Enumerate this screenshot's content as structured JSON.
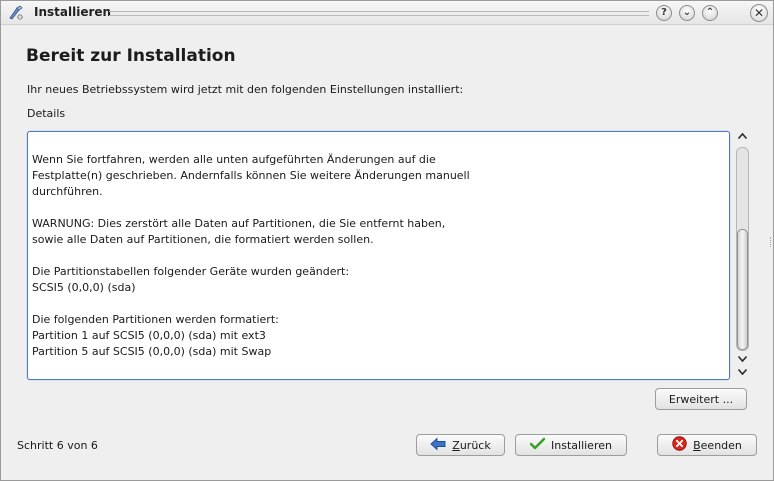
{
  "window": {
    "title": "Installieren",
    "help_glyph": "?",
    "min_glyph": "⌄",
    "max_glyph": "⌃",
    "close_glyph": "✕"
  },
  "page": {
    "title": "Bereit zur Installation",
    "intro": "Ihr neues Betriebssystem wird jetzt mit den folgenden Einstellungen installiert:",
    "details_label": "Details"
  },
  "details": {
    "text": "Wenn Sie fortfahren, werden alle unten aufgeführten Änderungen auf die\nFestplatte(n) geschrieben. Andernfalls können Sie weitere Änderungen manuell\ndurchführen.\n\nWARNUNG: Dies zerstört alle Daten auf Partitionen, die Sie entfernt haben,\nsowie alle Daten auf Partitionen, die formatiert werden sollen.\n\nDie Partitionstabellen folgender Geräte wurden geändert:\nSCSI5 (0,0,0) (sda)\n\nDie folgenden Partitionen werden formatiert:\nPartition 1 auf SCSI5 (0,0,0) (sda) mit ext3\nPartition 5 auf SCSI5 (0,0,0) (sda) mit Swap",
    "scroll_position": 0.45,
    "scroll_visible_fraction": 0.6
  },
  "buttons": {
    "advanced": "Erweitert ...",
    "back_pre": "",
    "back_mnemonic": "Z",
    "back_post": "urück",
    "install": "Installieren",
    "quit_pre": "",
    "quit_mnemonic": "B",
    "quit_post": "eenden"
  },
  "footer": {
    "step": "Schritt 6 von 6"
  },
  "icons": {
    "app": "installer-icon",
    "back": "arrow-left-icon",
    "install": "checkmark-icon",
    "quit": "cancel-icon"
  },
  "colors": {
    "focus_border": "#4d7bc4",
    "install_check": "#3aa12e",
    "quit_red": "#d8261c",
    "back_arrow": "#2f64b8"
  }
}
